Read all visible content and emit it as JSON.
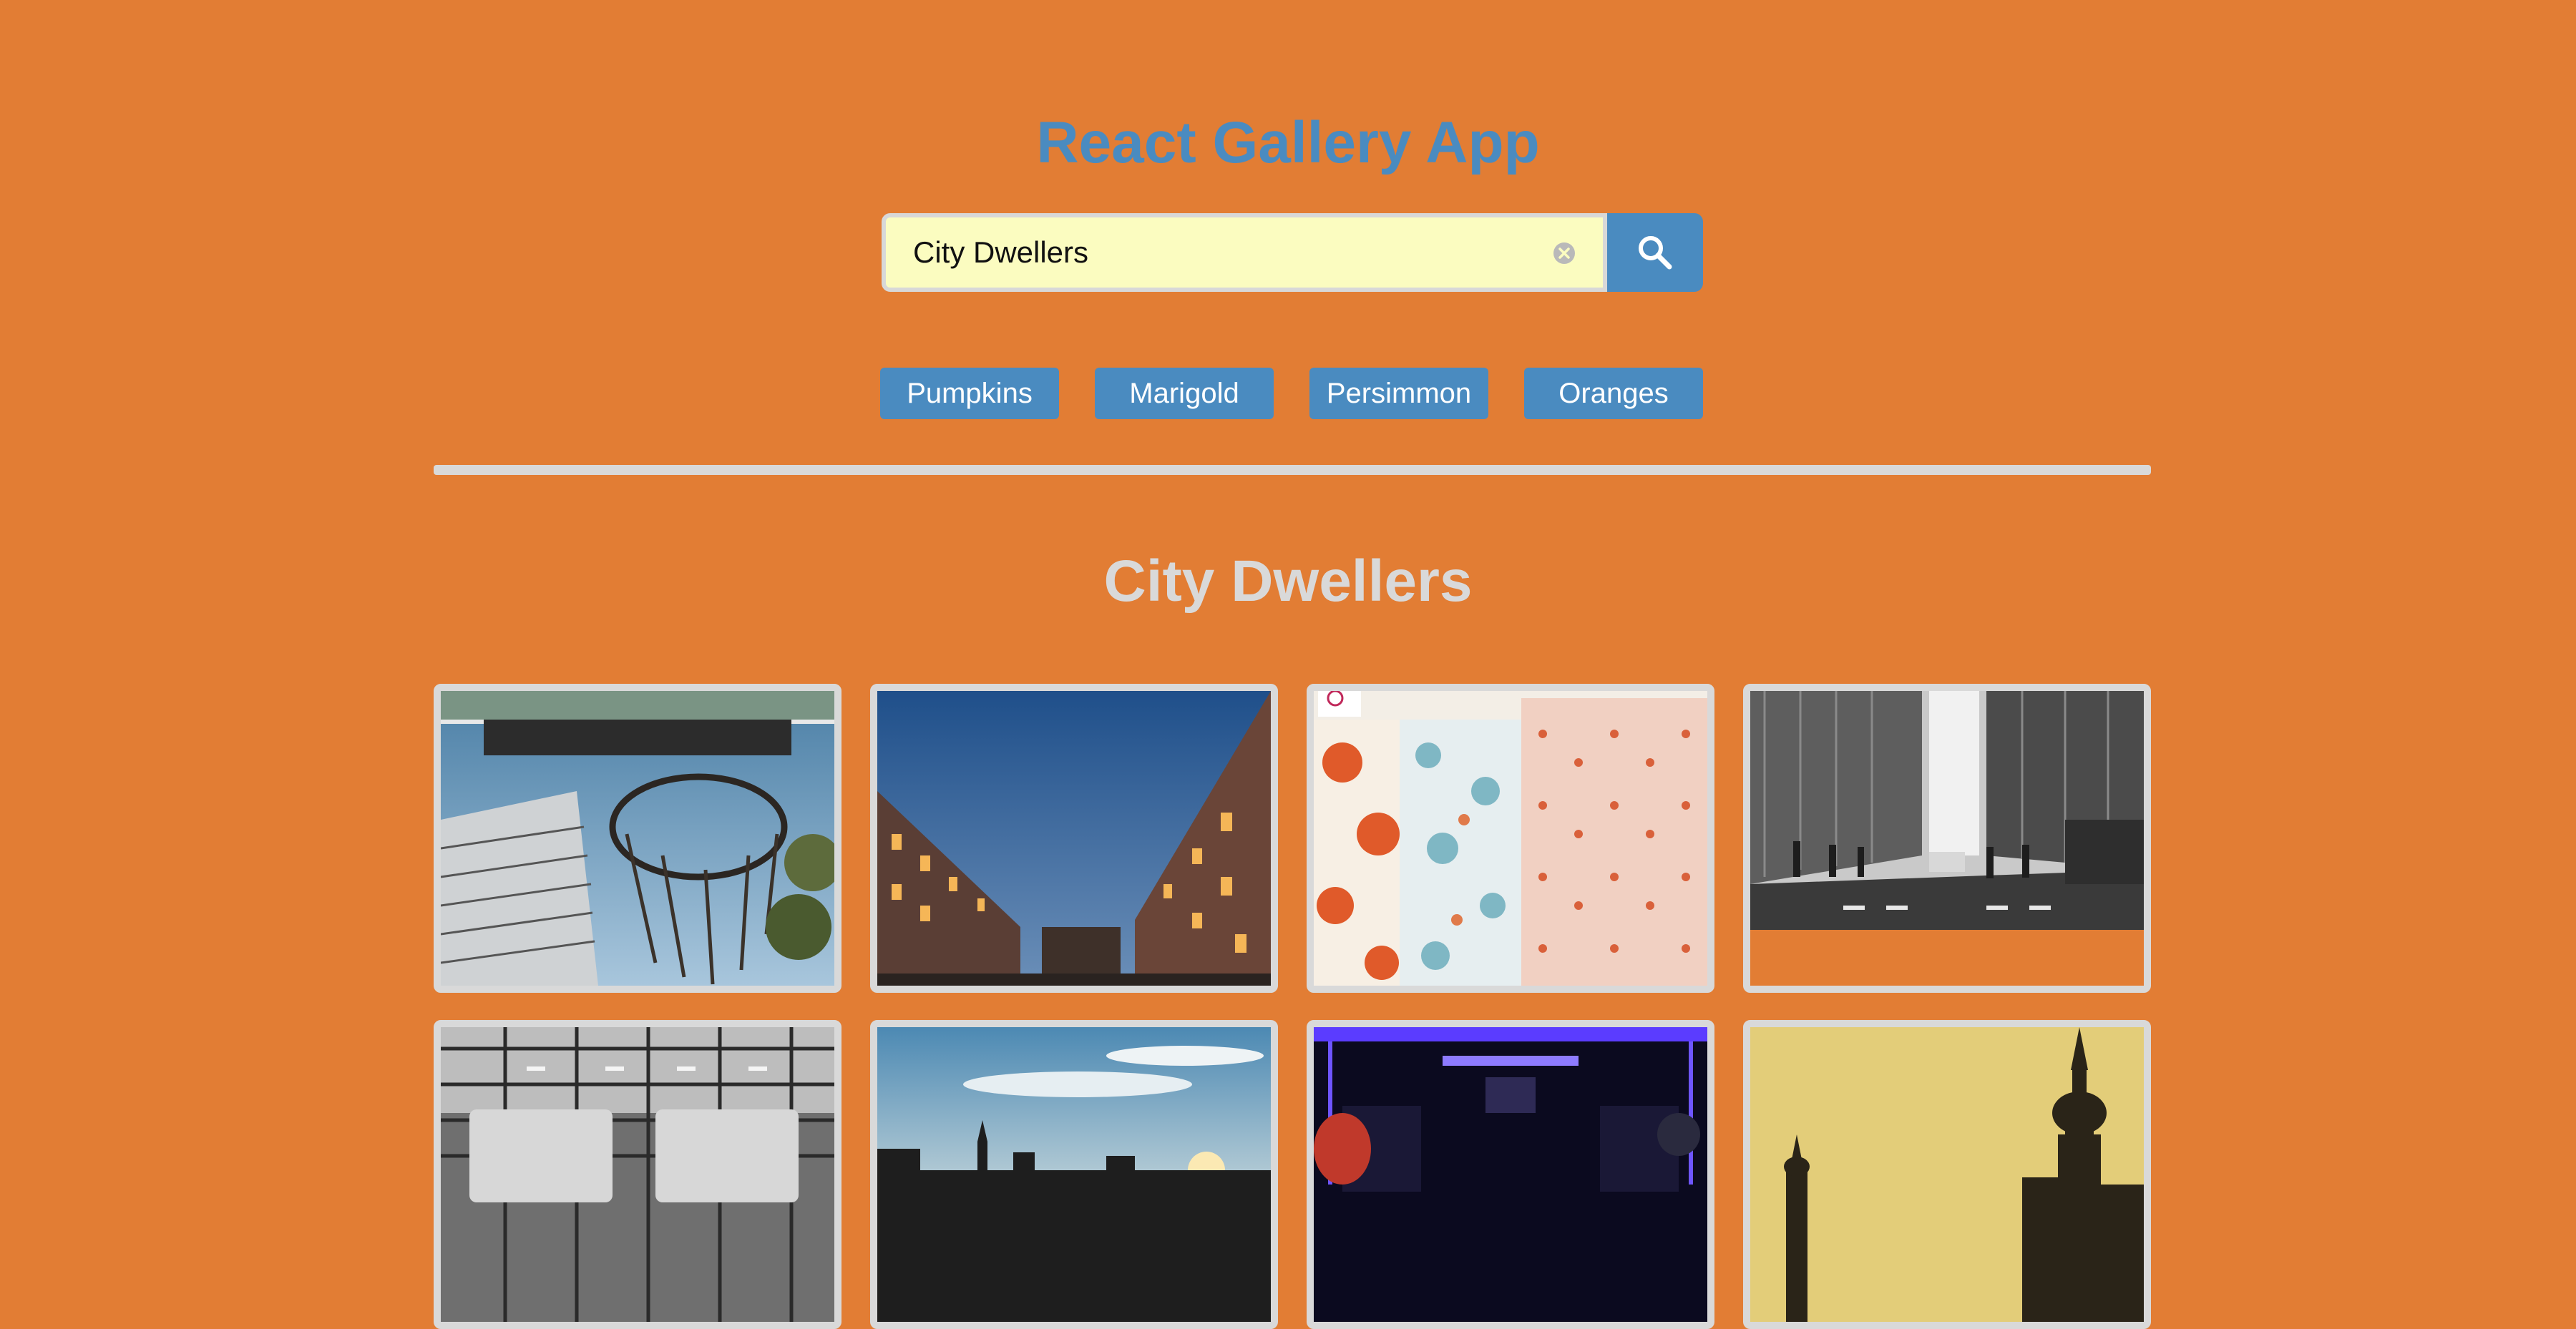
{
  "header": {
    "title": "React Gallery App"
  },
  "search": {
    "value": "City Dwellers",
    "clear_icon": "clear-circle-icon",
    "button_icon": "search-icon"
  },
  "nav": {
    "items": [
      {
        "label": "Pumpkins"
      },
      {
        "label": "Marigold"
      },
      {
        "label": "Persimmon"
      },
      {
        "label": "Oranges"
      }
    ]
  },
  "results": {
    "title": "City Dwellers",
    "photos": [
      {
        "subject": "basketball hoop with chain net in front of apartment tower"
      },
      {
        "subject": "street lined with lit buildings at dusk"
      },
      {
        "subject": "patterned fabric panels"
      },
      {
        "subject": "black and white city street crossing"
      },
      {
        "subject": "black and white bus depot"
      },
      {
        "subject": "city skyline at sunset"
      },
      {
        "subject": "bus interior with purple lights"
      },
      {
        "subject": "sepia church spires"
      }
    ]
  },
  "colors": {
    "background": "#e27d34",
    "accent": "#4a8bc0",
    "input_background": "#fbfcc0",
    "border": "#d9d9d9"
  }
}
